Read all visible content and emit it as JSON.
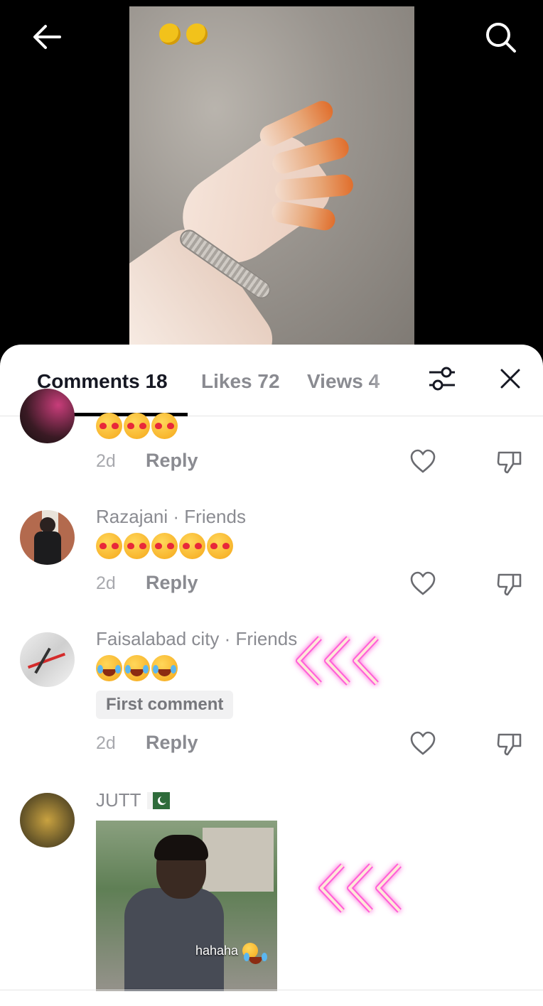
{
  "tabs": {
    "comments": "Comments 18",
    "likes": "Likes 72",
    "views": "Views 4"
  },
  "comments": [
    {
      "username": "",
      "emojis": [
        "love",
        "love",
        "love"
      ],
      "time": "2d",
      "reply": "Reply"
    },
    {
      "username": "Razajani · Friends",
      "emojis": [
        "love",
        "love",
        "love",
        "love",
        "love"
      ],
      "time": "2d",
      "reply": "Reply"
    },
    {
      "username": "Faisalabad city · Friends",
      "emojis": [
        "laugh",
        "laugh",
        "laugh"
      ],
      "badge": "First comment",
      "time": "2d",
      "reply": "Reply"
    },
    {
      "username": "JUTT",
      "gif_caption": "hahaha"
    }
  ],
  "icons": {
    "back": "back-arrow-icon",
    "search": "search-icon",
    "filter": "filter-sliders-icon",
    "close": "close-icon",
    "like": "heart-icon",
    "dislike": "thumbs-down-icon"
  }
}
